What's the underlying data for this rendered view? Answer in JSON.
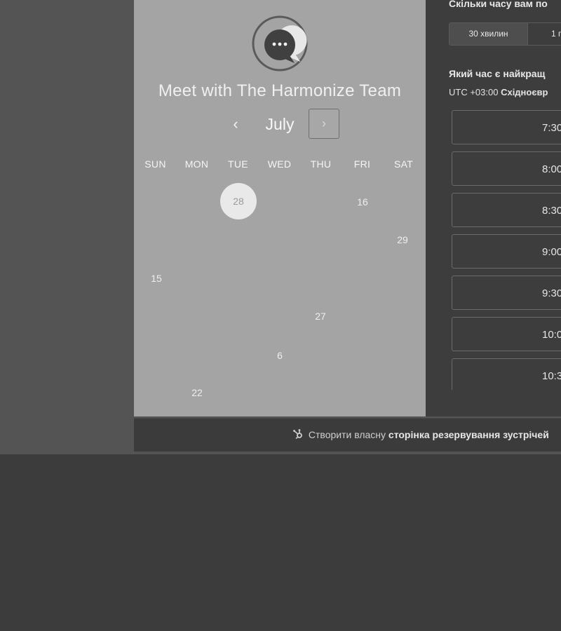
{
  "team_title": "Meet with The Harmonize Team",
  "calendar": {
    "month": "July",
    "prev_label": "‹",
    "next_label": "›",
    "weekdays": [
      "SUN",
      "MON",
      "TUE",
      "WED",
      "THU",
      "FRI",
      "SAT"
    ],
    "days": [
      {
        "label": "28",
        "selected": true
      },
      {
        "label": "16",
        "selected": false
      },
      {
        "label": "29",
        "selected": false
      },
      {
        "label": "15",
        "selected": false
      },
      {
        "label": "27",
        "selected": false
      },
      {
        "label": "6",
        "selected": false
      },
      {
        "label": "22",
        "selected": false
      }
    ]
  },
  "booking": {
    "duration_question": "Скільки часу вам по",
    "duration_options": [
      "30 хвилин",
      "1 г"
    ],
    "time_question": "Який час є найкращ",
    "timezone_offset": "UTC +03:00",
    "timezone_name": "Східноєвр",
    "slots": [
      "7:30",
      "8:00",
      "8:30",
      "9:00",
      "9:30",
      "10:0",
      "10:3"
    ]
  },
  "footer": {
    "prefix": "Створити власну",
    "emphasis": "сторінка резервування зустрічей"
  },
  "icons": {
    "logo": "chat-bubble-logo-icon",
    "footer": "hubspot-sprocket-icon"
  },
  "colors": {
    "left_panel": "#a4a4a4",
    "right_panel": "#3d3d3d",
    "selected_day": "#e9e9e9"
  }
}
